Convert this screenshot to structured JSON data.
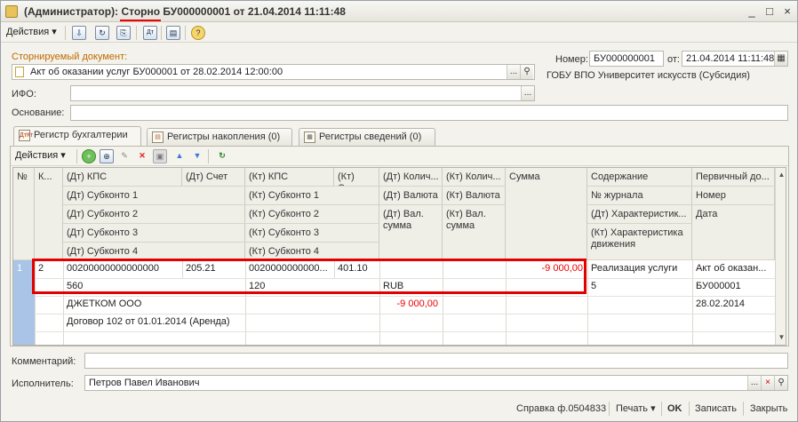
{
  "window": {
    "title_prefix": "(Администратор):",
    "title_storno": "Сторно",
    "title_rest": "БУ000000001 от 21.04.2014 11:11:48",
    "controls": [
      "_",
      "□",
      "×"
    ]
  },
  "toolbar": {
    "actions_label": "Действия",
    "icons": [
      "post-icon",
      "refresh-icon",
      "copy-doc-icon",
      "dt-kt-icon",
      "report-icon",
      "help-icon"
    ],
    "icon_glyphs": [
      "⇩",
      "↻",
      "⎘",
      "Дт",
      "▤",
      "?"
    ]
  },
  "form": {
    "reversed_doc_label": "Сторнируемый документ:",
    "reversed_doc_value": "Акт об оказании услуг БУ000001 от 28.02.2014 12:00:00",
    "ifo_label": "ИФО:",
    "ifo_value": "",
    "basis_label": "Основание:",
    "basis_value": "",
    "number_label": "Номер:",
    "number_value": "БУ000000001",
    "date_label": "от:",
    "date_value": "21.04.2014 11:11:48",
    "organization": "ГОБУ ВПО Университет искусств (Субсидия)"
  },
  "tabs": [
    {
      "label": "Регистр бухгалтерии",
      "icon": "accounting-register-icon",
      "glyph": "ДтКт"
    },
    {
      "label": "Регистры накопления (0)",
      "icon": "accumulation-register-icon",
      "glyph": "▤"
    },
    {
      "label": "Регистры сведений (0)",
      "icon": "info-register-icon",
      "glyph": "▦"
    }
  ],
  "subtoolbar": {
    "actions_label": "Действия",
    "icons": [
      "add-icon",
      "add-copy-icon",
      "edit-icon",
      "delete-icon",
      "post-grid-icon",
      "move-up-icon",
      "move-down-icon",
      "refresh-grid-icon"
    ],
    "glyphs": [
      "+",
      "⊕",
      "✎",
      "✕",
      "▣",
      "▲",
      "▼",
      "↻"
    ]
  },
  "grid": {
    "headers": {
      "num": "№",
      "k": "К...",
      "dt_kps": "(Дт) КПС",
      "dt_account": "(Дт) Счет",
      "kt_kps": "(Кт) КПС",
      "kt_account": "(Кт) Счет",
      "dt_qty": "(Дт) Колич...",
      "kt_qty": "(Кт) Колич...",
      "sum": "Сумма",
      "content": "Содержание",
      "primary_doc": "Первичный до...",
      "dt_sub1": "(Дт) Субконто 1",
      "kt_sub1": "(Кт) Субконто 1",
      "dt_currency": "(Дт) Валюта",
      "kt_currency": "(Кт) Валюта",
      "journal_no": "№ журнала",
      "number": "Номер",
      "dt_sub2": "(Дт) Субконто 2",
      "kt_sub2": "(Кт) Субконто 2",
      "dt_cur_sum": "(Дт) Вал. сумма",
      "kt_cur_sum": "(Кт) Вал. сумма",
      "dt_char": "(Дт) Характеристик...",
      "date": "Дата",
      "dt_sub3": "(Дт) Субконто 3",
      "kt_sub3": "(Кт) Субконто 3",
      "kt_char": "(Кт) Характеристика движения",
      "dt_sub4": "(Дт) Субконто 4",
      "kt_sub4": "(Кт) Субконто 4"
    },
    "row": {
      "num": "1",
      "k": "2",
      "dt_kps": "00200000000000000",
      "dt_account": "205.21",
      "kt_kps": "0020000000000...",
      "kt_account": "401.10",
      "sum": "-9 000,00",
      "content": "Реализация услуги",
      "primary_doc": "Акт об оказан...",
      "dt_sub1": "560",
      "kt_sub1": "120",
      "dt_currency": "RUB",
      "journal_no": "5",
      "number": "БУ000001",
      "dt_sub2": "ДЖЕТКОМ ООО",
      "dt_cur_sum": "-9 000,00",
      "date": "28.02.2014",
      "dt_sub3": "Договор 102 от 01.01.2014 (Аренда)"
    }
  },
  "bottom": {
    "comment_label": "Комментарий:",
    "comment_value": "",
    "executor_label": "Исполнитель:",
    "executor_value": "Петров Павел Иванович",
    "buttons": {
      "certificate": "Справка ф.0504833",
      "print": "Печать",
      "ok": "OK",
      "save": "Записать",
      "close": "Закрыть"
    }
  },
  "colors": {
    "highlight": "#e30000",
    "negative": "#e00000",
    "label_orange": "#c06a00",
    "selected_row": "#a9c4e6"
  }
}
